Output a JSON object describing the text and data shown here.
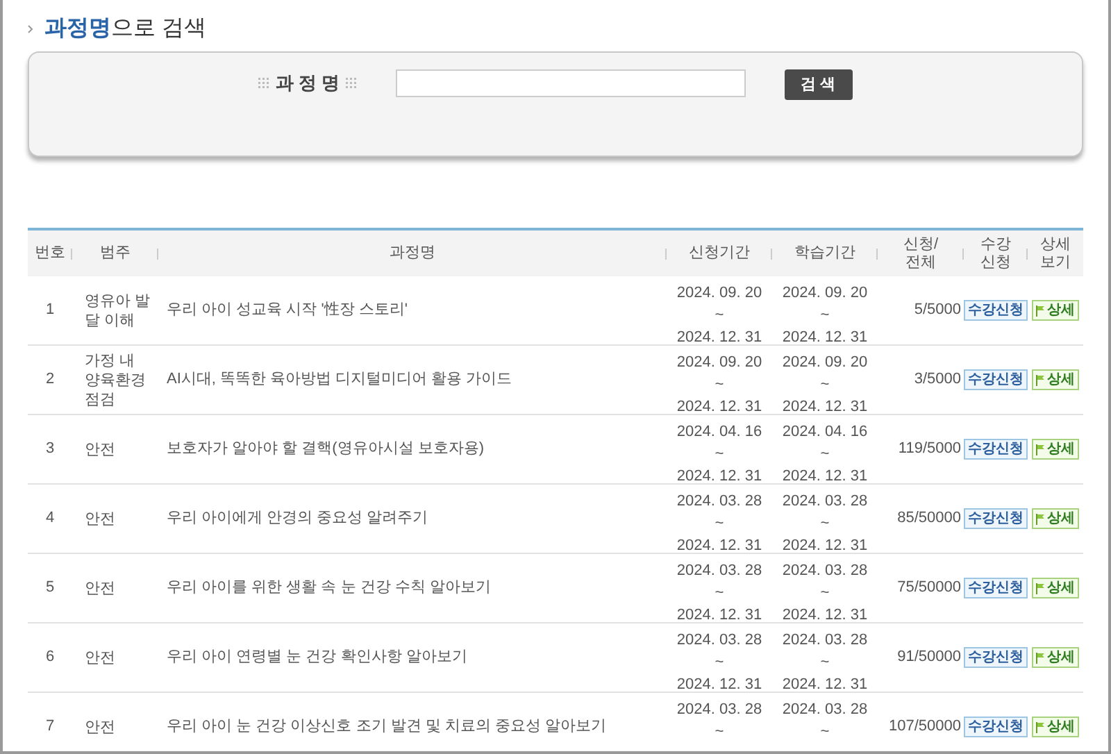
{
  "title": {
    "highlight": "과정명",
    "rest": "으로 검색"
  },
  "search": {
    "label": "과 정 명",
    "button": "검 색"
  },
  "table": {
    "columns": [
      "번호",
      "범주",
      "과정명",
      "신청기간",
      "학습기간",
      "신청/\n전체",
      "수강\n신청",
      "상세\n보기"
    ],
    "rows": [
      {
        "no": "1",
        "category": "영유아 발달 이해",
        "course": "우리 아이 성교육 시작 '性장 스토리'",
        "apply": [
          "2024. 09. 20",
          "~",
          "2024. 12. 31"
        ],
        "study": [
          "2024. 09. 20",
          "~",
          "2024. 12. 31"
        ],
        "count": "5/5000",
        "enroll": "수강신청",
        "detail": "상세"
      },
      {
        "no": "2",
        "category": "가정 내 양육환경 점검",
        "course": "AI시대, 똑똑한 육아방법 디지털미디어 활용 가이드",
        "apply": [
          "2024. 09. 20",
          "~",
          "2024. 12. 31"
        ],
        "study": [
          "2024. 09. 20",
          "~",
          "2024. 12. 31"
        ],
        "count": "3/5000",
        "enroll": "수강신청",
        "detail": "상세"
      },
      {
        "no": "3",
        "category": "안전",
        "course": "보호자가 알아야 할 결핵(영유아시설 보호자용)",
        "apply": [
          "2024. 04. 16",
          "~",
          "2024. 12. 31"
        ],
        "study": [
          "2024. 04. 16",
          "~",
          "2024. 12. 31"
        ],
        "count": "119/5000",
        "enroll": "수강신청",
        "detail": "상세"
      },
      {
        "no": "4",
        "category": "안전",
        "course": "우리 아이에게 안경의 중요성 알려주기",
        "apply": [
          "2024. 03. 28",
          "~",
          "2024. 12. 31"
        ],
        "study": [
          "2024. 03. 28",
          "~",
          "2024. 12. 31"
        ],
        "count": "85/50000",
        "enroll": "수강신청",
        "detail": "상세"
      },
      {
        "no": "5",
        "category": "안전",
        "course": "우리 아이를 위한 생활 속 눈 건강 수칙 알아보기",
        "apply": [
          "2024. 03. 28",
          "~",
          "2024. 12. 31"
        ],
        "study": [
          "2024. 03. 28",
          "~",
          "2024. 12. 31"
        ],
        "count": "75/50000",
        "enroll": "수강신청",
        "detail": "상세"
      },
      {
        "no": "6",
        "category": "안전",
        "course": "우리 아이 연령별 눈 건강 확인사항 알아보기",
        "apply": [
          "2024. 03. 28",
          "~",
          "2024. 12. 31"
        ],
        "study": [
          "2024. 03. 28",
          "~",
          "2024. 12. 31"
        ],
        "count": "91/50000",
        "enroll": "수강신청",
        "detail": "상세"
      },
      {
        "no": "7",
        "category": "안전",
        "course": "우리 아이 눈 건강 이상신호 조기 발견 및 치료의 중요성 알아보기",
        "apply": [
          "2024. 03. 28",
          "~"
        ],
        "study": [
          "2024. 03. 28",
          "~"
        ],
        "count": "107/50000",
        "enroll": "수강신청",
        "detail": "상세"
      }
    ]
  }
}
